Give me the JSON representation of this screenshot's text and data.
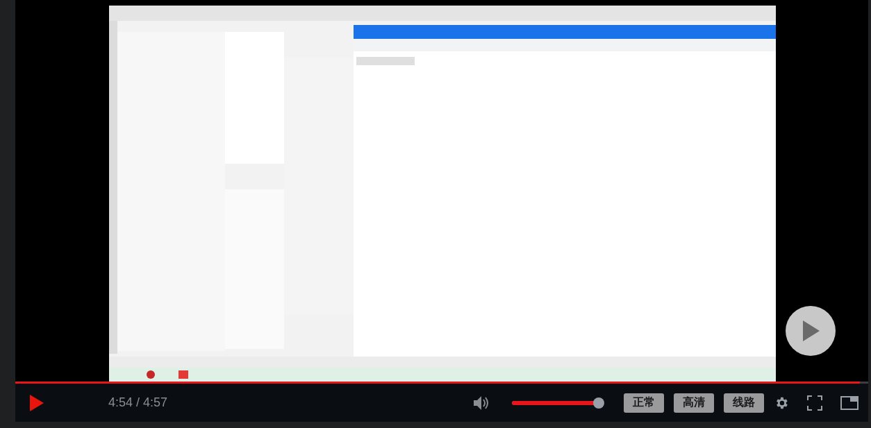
{
  "progress": {
    "level": 0.99
  },
  "controls": {
    "time": "4:54 / 4:57",
    "volume": {
      "level": 1,
      "muted": false
    },
    "buttons": [
      {
        "label": "正常"
      },
      {
        "label": "高清"
      },
      {
        "label": "线路"
      }
    ]
  }
}
